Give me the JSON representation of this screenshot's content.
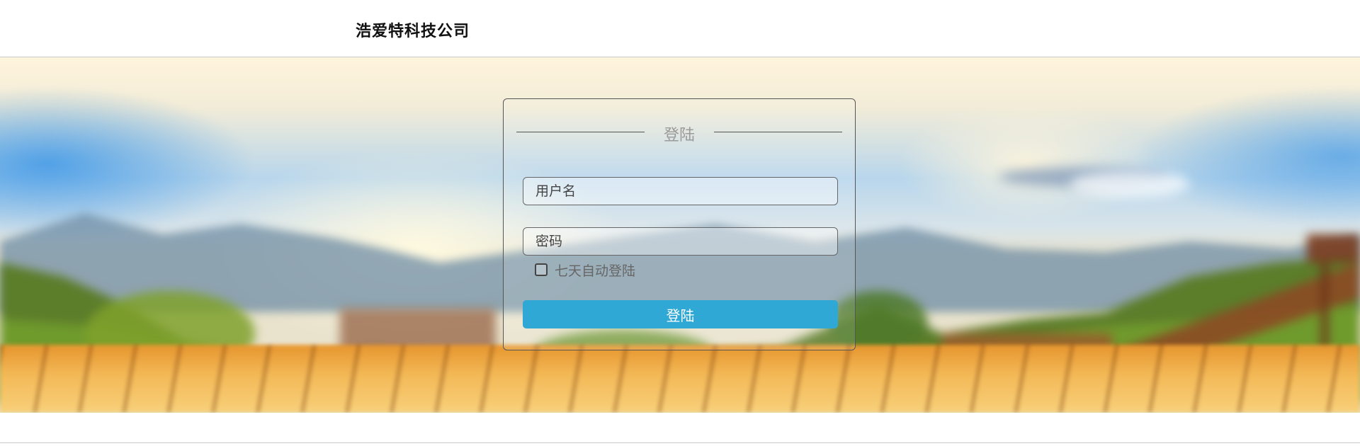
{
  "header": {
    "company_name": "浩爱特科技公司"
  },
  "login": {
    "title": "登陆",
    "username": {
      "value": "",
      "placeholder": "用户名"
    },
    "password": {
      "value": "",
      "placeholder": "密码"
    },
    "remember": {
      "label": "七天自动登陆",
      "checked": false
    },
    "submit_label": "登陆"
  },
  "colors": {
    "button": "#2fa8d6",
    "text": "#111111",
    "muted": "#9a9a9a"
  }
}
